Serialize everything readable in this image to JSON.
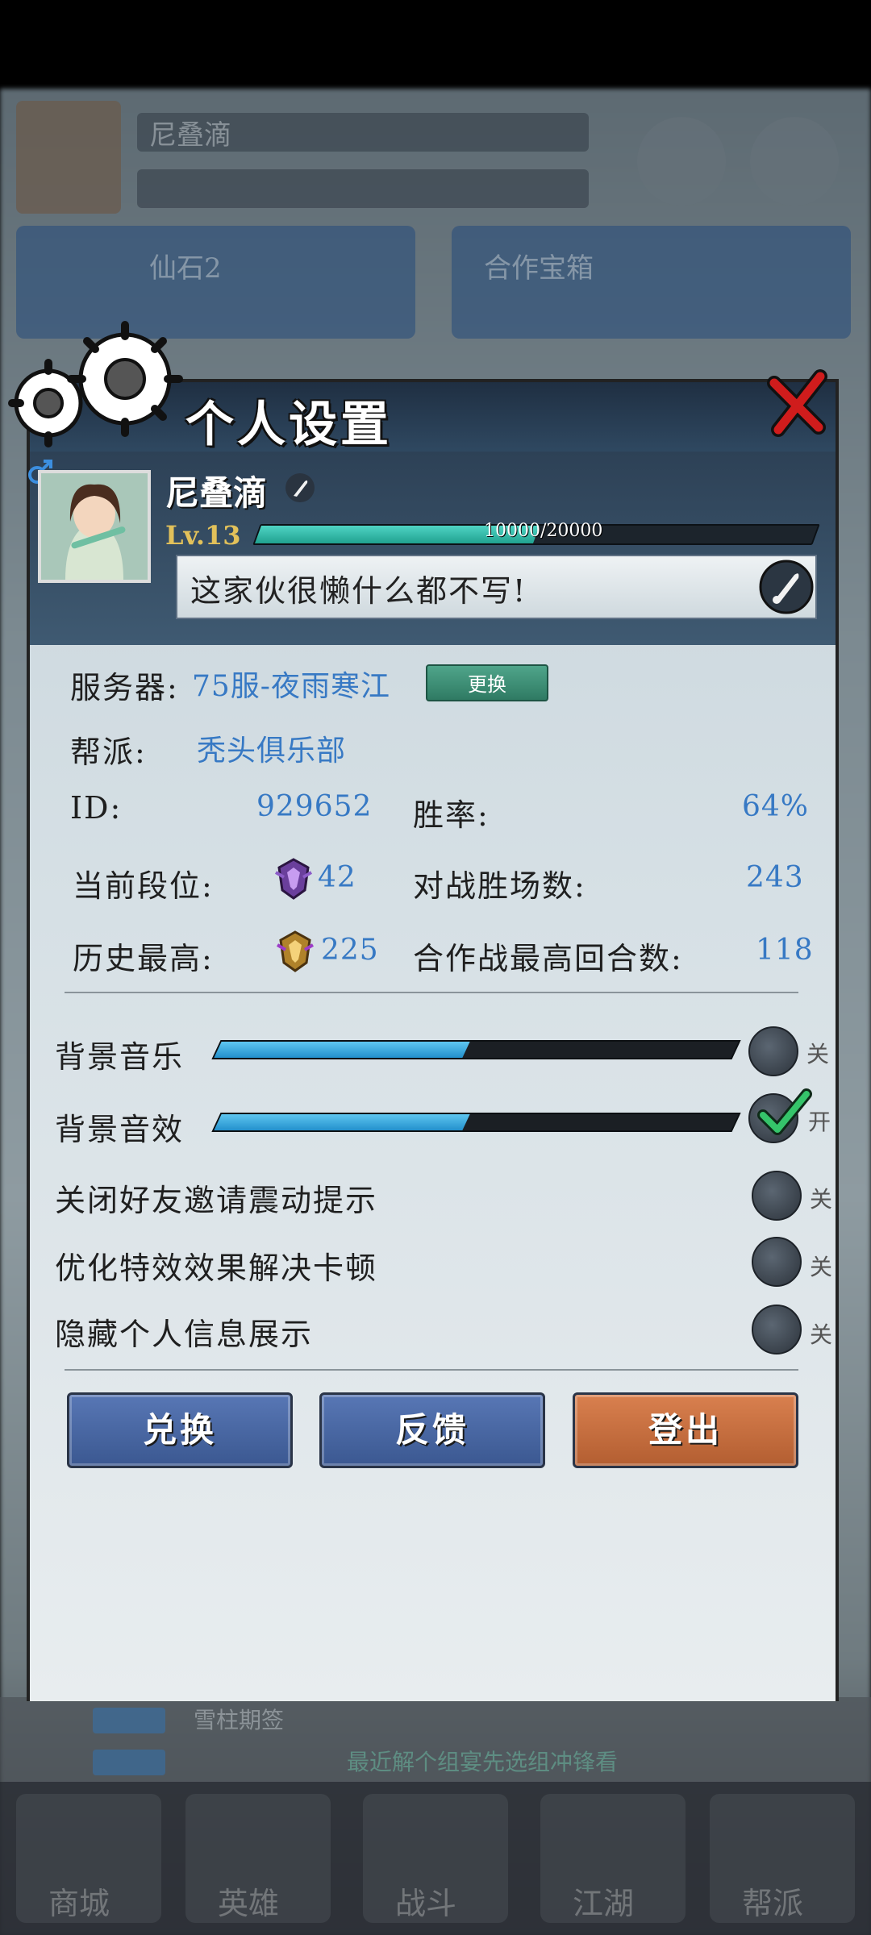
{
  "background": {
    "player_name": "尼叠滴",
    "panel_left_label": "仙石2",
    "panel_right_label": "合作宝箱",
    "chat_line_1": "雪柱期签",
    "chat_line_2": "最近解个组宴先选组冲锋看",
    "nav_items": [
      "商城",
      "英雄",
      "战斗",
      "江湖",
      "帮派"
    ]
  },
  "dialog": {
    "title": "个人设置",
    "profile": {
      "name": "尼叠滴",
      "level": "Lv.13",
      "exp_text": "10000/20000",
      "exp_fraction": 0.5,
      "signature": "这家伙很懒什么都不写!"
    },
    "info": {
      "server_label": "服务器:",
      "server_value": "75服-夜雨寒江",
      "change_label": "更换",
      "guild_label": "帮派:",
      "guild_value": "秃头俱乐部",
      "id_label": "ID:",
      "id_value": "929652",
      "winrate_label": "胜率:",
      "winrate_value": "64%",
      "rank_label": "当前段位:",
      "rank_value": "42",
      "wins_label": "对战胜场数:",
      "wins_value": "243",
      "best_label": "历史最高:",
      "best_value": "225",
      "coop_label": "合作战最高回合数:",
      "coop_value": "118"
    },
    "settings": [
      {
        "label": "背景音乐",
        "state": "关",
        "volume": 0.48
      },
      {
        "label": "背景音效",
        "state": "开",
        "volume": 0.48
      },
      {
        "label": "关闭好友邀请震动提示",
        "state": "关"
      },
      {
        "label": "优化特效效果解决卡顿",
        "state": "关"
      },
      {
        "label": "隐藏个人信息展示",
        "state": "关"
      }
    ],
    "buttons": {
      "redeem": "兑换",
      "feedback": "反馈",
      "logout": "登出"
    }
  },
  "colors": {
    "accent_blue": "#3779c4",
    "slider_blue": "#2390cc",
    "exp_teal": "#20a18f",
    "logout_orange": "#b35e31",
    "close_red": "#d01c1c"
  }
}
